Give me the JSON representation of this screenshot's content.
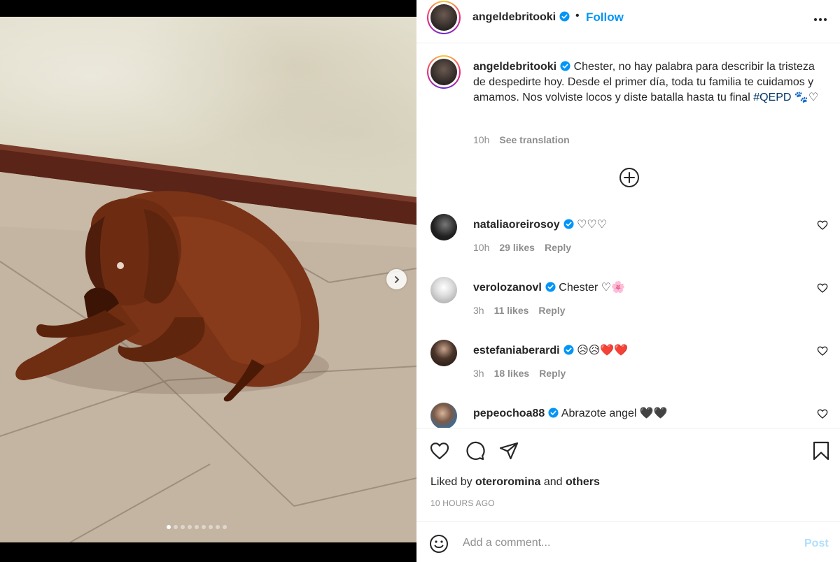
{
  "post": {
    "author": "angeldebritooki",
    "follow_separator": "•",
    "follow_label": "Follow",
    "verified_color": "#0095f6",
    "carousel": {
      "slide_count": 9,
      "current_slide": 1
    }
  },
  "caption": {
    "author": "angeldebritooki",
    "text": "Chester, no hay palabra para describir la tristeza de despedirte hoy. Desde el primer día, toda tu familia te cuidamos y amamos. Nos volviste locos y diste batalla hasta tu final ",
    "hashtag": "#QEPD",
    "emojis": "🐾♡",
    "time": "10h",
    "translation_label": "See translation"
  },
  "comments": [
    {
      "user": "nataliaoreirosoy",
      "text": "♡♡♡",
      "time": "10h",
      "likes": "29 likes",
      "reply": "Reply"
    },
    {
      "user": "verolozanovl",
      "text": "Chester ♡🌸",
      "time": "3h",
      "likes": "11 likes",
      "reply": "Reply"
    },
    {
      "user": "estefaniaberardi",
      "text": "😥😥❤️❤️",
      "time": "3h",
      "likes": "18 likes",
      "reply": "Reply"
    },
    {
      "user": "pepeochoa88",
      "text": "Abrazote angel 🖤🖤"
    }
  ],
  "footer": {
    "liked_prefix": "Liked by ",
    "liked_user": "oteroromina",
    "liked_and": " and ",
    "liked_others": "others",
    "time_ago": "10 HOURS AGO",
    "comment_placeholder": "Add a comment...",
    "post_label": "Post"
  },
  "colors": {
    "link": "#0095f6",
    "hashtag": "#00376b",
    "muted": "#8e8e8e",
    "post_disabled": "#b2dffc"
  },
  "icons": [
    "verified-badge-icon",
    "more-options-icon",
    "next-arrow-icon",
    "add-circle-icon",
    "heart-icon",
    "comment-icon",
    "share-icon",
    "bookmark-icon",
    "emoji-icon"
  ]
}
